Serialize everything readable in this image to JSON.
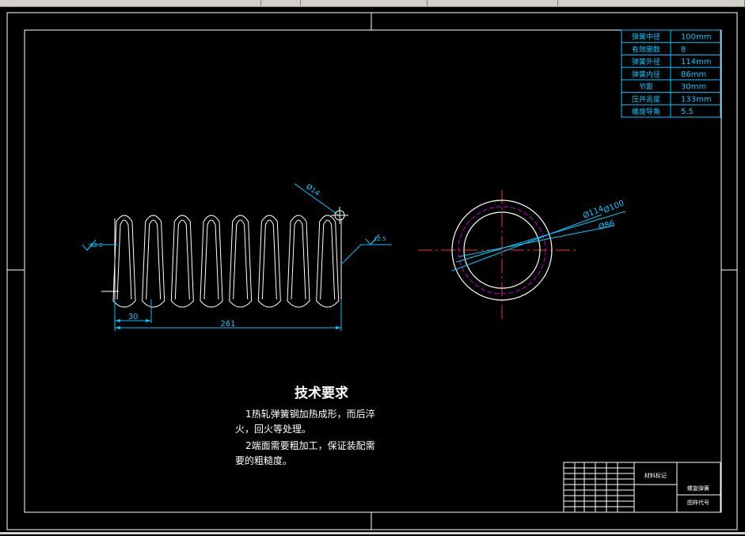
{
  "app": {
    "toolbar_segments": [
      "",
      "",
      "",
      "",
      ""
    ]
  },
  "colors": {
    "background": "#000000",
    "outline": "#ffffff",
    "dimension": "#00c8ff",
    "centerline": "#ff2a2a",
    "hidden": "#c000c0"
  },
  "params_table": {
    "rows": [
      {
        "label": "弹簧中径",
        "value": "100mm"
      },
      {
        "label": "有效圈数",
        "value": "8"
      },
      {
        "label": "弹簧外径",
        "value": "114mm"
      },
      {
        "label": "弹簧内径",
        "value": "86mm"
      },
      {
        "label": "节距",
        "value": "30mm"
      },
      {
        "label": "压并高度",
        "value": "133mm"
      },
      {
        "label": "螺旋导角",
        "value": "5.5"
      }
    ]
  },
  "dims": {
    "wire_dia": "Ø14",
    "roughness_left": "12.5",
    "roughness_right": "12.5",
    "pitch": "30",
    "length": "261",
    "outer_dia": "Ø114",
    "mean_dia": "Ø100",
    "inner_dia": "Ø86"
  },
  "tech": {
    "title": "技术要求",
    "line1": "1热轧弹簧钢加热成形，而后淬",
    "line2": "火，回火等处理。",
    "line3": "2端面需要粗加工，保证装配需",
    "line4": "要的粗糙度。"
  },
  "title_block": {
    "material_mark": "材料标记",
    "part_name": "螺旋弹簧",
    "drawing_no": "图样代号"
  }
}
